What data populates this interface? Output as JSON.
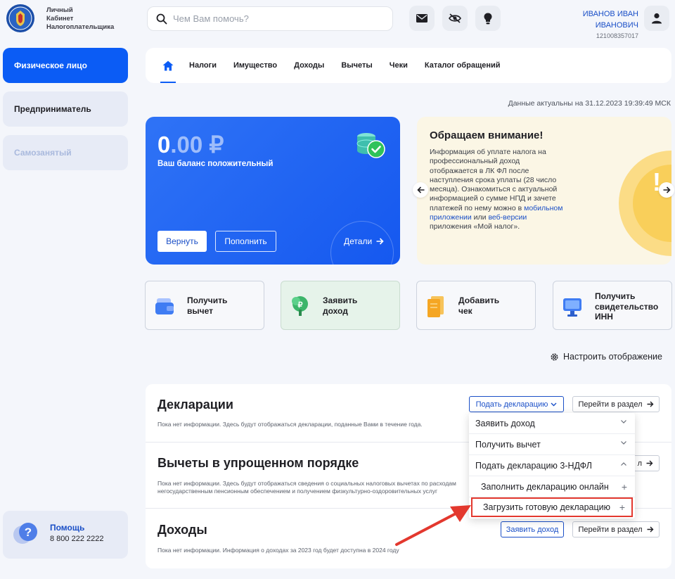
{
  "header": {
    "logo_text": [
      "Личный",
      "Кабинет",
      "Налогоплательщика"
    ],
    "search_placeholder": "Чем Вам помочь?",
    "user_name_line1": "ИВАНОВ ИВАН",
    "user_name_line2": "ИВАНОВИЧ",
    "user_inn": "121008357017"
  },
  "sidebar": {
    "items": [
      {
        "label": "Физическое лицо",
        "state": "active"
      },
      {
        "label": "Предприниматель",
        "state": "normal"
      },
      {
        "label": "Самозанятый",
        "state": "disabled"
      }
    ],
    "help_title": "Помощь",
    "help_phone": "8 800 222 2222"
  },
  "nav": {
    "tabs": [
      "Налоги",
      "Имущество",
      "Доходы",
      "Вычеты",
      "Чеки",
      "Каталог обращений"
    ]
  },
  "updated_text": "Данные актуальны на 31.12.2023 19:39:49 МСК",
  "balance": {
    "amount_int": "0",
    "amount_dec": ".00 ₽",
    "status": "Ваш баланс положительный",
    "return_label": "Вернуть",
    "topup_label": "Пополнить",
    "details_label": "Детали"
  },
  "notice": {
    "title": "Обращаем внимание!",
    "text_part1": "Информация об уплате налога на профессиональный доход отображается в ЛК ФЛ после наступления срока уплаты (28 число месяца).",
    "text_part2": "Ознакомиться с актуальной информацией о сумме НПД и зачете платежей по нему можно в",
    "link1": "мобильном приложении",
    "text_or": "или",
    "link2": "веб-версии",
    "text_part3": "приложения «Мой налог».",
    "mark": "!"
  },
  "quick_actions": [
    {
      "label_line1": "Получить",
      "label_line2": "вычет",
      "label_line3": ""
    },
    {
      "label_line1": "Заявить",
      "label_line2": "доход",
      "label_line3": ""
    },
    {
      "label_line1": "Добавить",
      "label_line2": "чек",
      "label_line3": ""
    },
    {
      "label_line1": "Получить",
      "label_line2": "свидетельство",
      "label_line3": "ИНН"
    }
  ],
  "configure_label": "Настроить отображение",
  "sections": {
    "declarations": {
      "title": "Декларации",
      "desc": "Пока нет информации. Здесь будут отображаться декларации, поданные Вами в течение года.",
      "submit_label": "Подать декларацию",
      "goto_label": "Перейти в раздел"
    },
    "deductions": {
      "title": "Вычеты в упрощенном порядке",
      "desc_line1": "Пока нет информации. Здесь будут отображаться сведения о социальных налоговых вычетах по расходам",
      "desc_line2": "негосударственным пенсионным обеспечением и получением физкультурно-оздоровительных услуг",
      "goto_label_partial": "л"
    },
    "income": {
      "title": "Доходы",
      "desc": "Пока нет информации. Информация о доходах за 2023 год будет доступна в 2024 году",
      "declare_label": "Заявить доход",
      "goto_label": "Перейти в раздел"
    }
  },
  "dropdown": {
    "items": [
      {
        "label": "Заявить доход",
        "type": "collapsed"
      },
      {
        "label": "Получить вычет",
        "type": "collapsed"
      },
      {
        "label": "Подать декларацию 3-НДФЛ",
        "type": "expanded"
      },
      {
        "label": "Заполнить декларацию онлайн",
        "type": "sub"
      },
      {
        "label": "Загрузить готовую декларацию",
        "type": "sub-highlighted"
      }
    ]
  },
  "colors": {
    "accent": "#0b5cf5",
    "link": "#1a4fc7",
    "highlight": "#e3382e",
    "notice_bg": "#fbf6e5"
  }
}
